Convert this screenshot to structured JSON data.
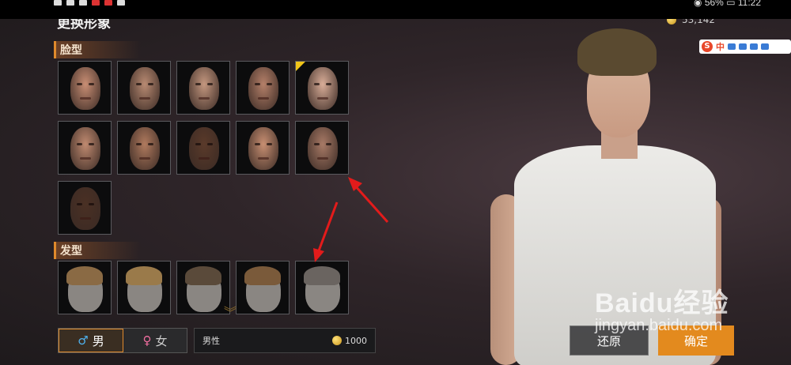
{
  "status_bar": {
    "right_text": "◉ 56% ▭ 11:22"
  },
  "page": {
    "title": "更换形象"
  },
  "sections": {
    "face_label": "脸型",
    "hair_label": "发型"
  },
  "faces": [
    {
      "skin": "#c98e74",
      "selected": false
    },
    {
      "skin": "#b88a72",
      "selected": false
    },
    {
      "skin": "#c4977f",
      "selected": false
    },
    {
      "skin": "#b58069",
      "selected": false
    },
    {
      "skin": "#d9ad98",
      "selected": true
    },
    {
      "skin": "#c08a70",
      "selected": false
    },
    {
      "skin": "#b07a5e",
      "selected": false
    },
    {
      "skin": "#5a3a2a",
      "selected": false
    },
    {
      "skin": "#c88f72",
      "selected": false
    },
    {
      "skin": "#a87a66",
      "selected": false
    },
    {
      "skin": "#4a3024",
      "selected": false
    }
  ],
  "hairs": [
    {
      "color": "#8a6a44"
    },
    {
      "color": "#9a7a4a"
    },
    {
      "color": "#5a4a3a"
    },
    {
      "color": "#7a5a3a"
    },
    {
      "color": "#6a6460"
    }
  ],
  "gender": {
    "male_label": "男",
    "female_label": "女",
    "selected": "male"
  },
  "price_bar": {
    "label": "男性",
    "price": "1000"
  },
  "currency": {
    "amount": "53,142"
  },
  "ime": {
    "text": "中"
  },
  "buttons": {
    "reset": "还原",
    "confirm": "确定"
  },
  "watermark": {
    "brand": "Baidu经验",
    "url": "jingyan.baidu.com"
  }
}
